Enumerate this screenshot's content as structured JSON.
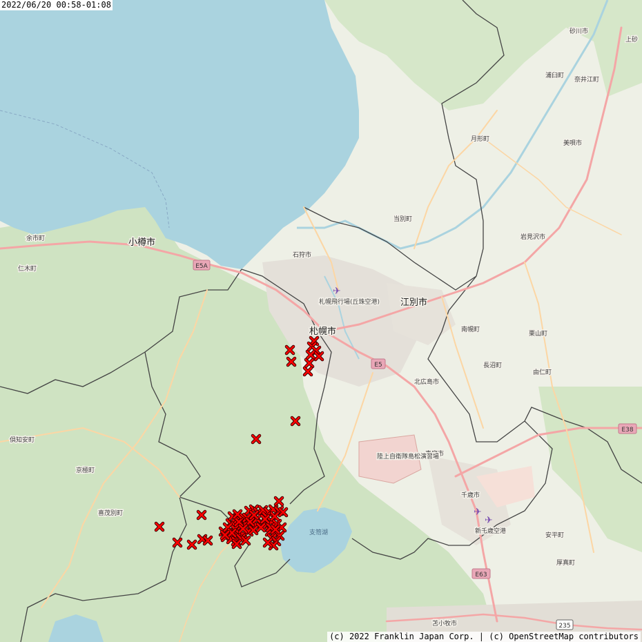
{
  "timestamp": "2022/06/20 00:58-01:08",
  "attribution": "(c) 2022 Franklin Japan Corp. | (c) OpenStreetMap contributors",
  "colors": {
    "sea": "#aad3df",
    "land": "#f2efe9",
    "forest": "#cfe3c2",
    "urban": "#e6e3dd",
    "road_major": "#f4a6a6",
    "road_minor": "#fcd6a4",
    "boundary": "#444444",
    "marker": "#ff0000",
    "military": "#f2d4d0"
  },
  "places": [
    {
      "id": "sapporo",
      "name": "札幌市",
      "class": "city"
    },
    {
      "id": "otaru",
      "name": "小樽市",
      "class": "city"
    },
    {
      "id": "ebetsu",
      "name": "江別市",
      "class": "city"
    },
    {
      "id": "sunagawa",
      "name": "砂川市",
      "class": "town"
    },
    {
      "id": "kamiutashinai",
      "name": "上砂",
      "class": "town"
    },
    {
      "id": "urausu",
      "name": "浦臼町",
      "class": "town"
    },
    {
      "id": "naie",
      "name": "奈井江町",
      "class": "town"
    },
    {
      "id": "tsukigata",
      "name": "月形町",
      "class": "town"
    },
    {
      "id": "bibai",
      "name": "美唄市",
      "class": "town"
    },
    {
      "id": "tobetsu",
      "name": "当別町",
      "class": "town"
    },
    {
      "id": "iwamizawa",
      "name": "岩見沢市",
      "class": "town"
    },
    {
      "id": "ishikari",
      "name": "石狩市",
      "class": "town"
    },
    {
      "id": "airport",
      "name": "札幌飛行場(丘珠空港)",
      "class": "town"
    },
    {
      "id": "nanporo",
      "name": "南幌町",
      "class": "town"
    },
    {
      "id": "kuriyama",
      "name": "栗山町",
      "class": "town"
    },
    {
      "id": "naganuma",
      "name": "長沼町",
      "class": "town"
    },
    {
      "id": "yuni",
      "name": "由仁町",
      "class": "town"
    },
    {
      "id": "kitahiroshima",
      "name": "北広島市",
      "class": "town"
    },
    {
      "id": "eniwa",
      "name": "恵庭市",
      "class": "town"
    },
    {
      "id": "chitose",
      "name": "千歳市",
      "class": "town"
    },
    {
      "id": "shinchitose",
      "name": "新千歳空港",
      "class": "town"
    },
    {
      "id": "abira",
      "name": "安平町",
      "class": "town"
    },
    {
      "id": "atsuma",
      "name": "厚真町",
      "class": "town"
    },
    {
      "id": "tomakomai",
      "name": "苫小牧市",
      "class": "town"
    },
    {
      "id": "yoichi",
      "name": "余市町",
      "class": "town"
    },
    {
      "id": "niki",
      "name": "仁木町",
      "class": "town"
    },
    {
      "id": "kutchan",
      "name": "倶知安町",
      "class": "town"
    },
    {
      "id": "kyogoku",
      "name": "京極町",
      "class": "town"
    },
    {
      "id": "kimobetsu",
      "name": "喜茂別町",
      "class": "town"
    },
    {
      "id": "shikotsu",
      "name": "支笏湖",
      "class": "water"
    },
    {
      "id": "military",
      "name": "陸上自衛隊島松演習場",
      "class": "town"
    }
  ],
  "roads": [
    {
      "ref": "E5A"
    },
    {
      "ref": "E5"
    },
    {
      "ref": "E38"
    },
    {
      "ref": "E63"
    },
    {
      "ref": "235"
    }
  ],
  "markers": {
    "symbol": "x",
    "count": 85
  }
}
